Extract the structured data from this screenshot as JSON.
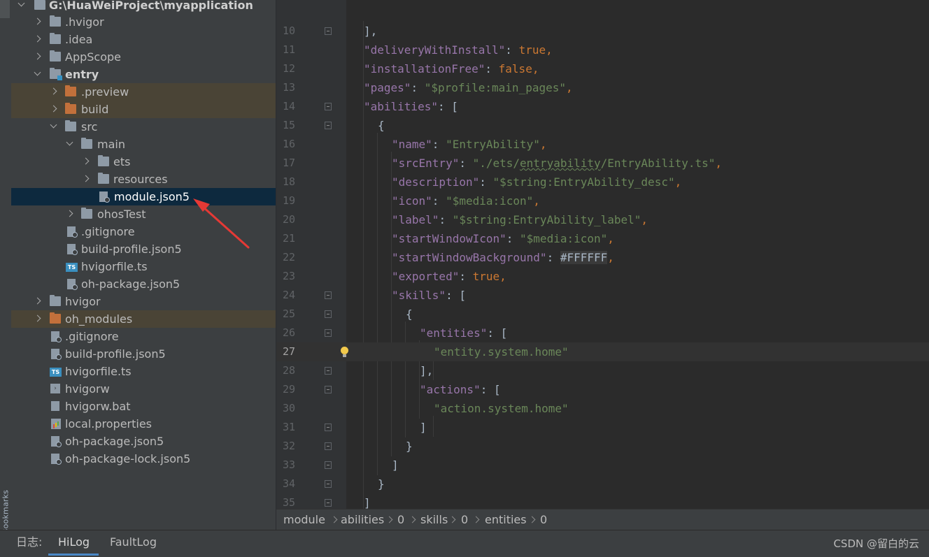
{
  "project_tree": {
    "root": "G:\\HuaWeiProject\\myapplication",
    "items": [
      {
        "label": ".hvigor"
      },
      {
        "label": ".idea"
      },
      {
        "label": "AppScope"
      },
      {
        "label": "entry"
      },
      {
        "label": ".preview"
      },
      {
        "label": "build"
      },
      {
        "label": "src"
      },
      {
        "label": "main"
      },
      {
        "label": "ets"
      },
      {
        "label": "resources"
      },
      {
        "label": "module.json5"
      },
      {
        "label": "ohosTest"
      },
      {
        "label": ".gitignore"
      },
      {
        "label": "build-profile.json5"
      },
      {
        "label": "hvigorfile.ts"
      },
      {
        "label": "oh-package.json5"
      },
      {
        "label": "hvigor"
      },
      {
        "label": "oh_modules"
      },
      {
        "label": ".gitignore"
      },
      {
        "label": "build-profile.json5"
      },
      {
        "label": "hvigorfile.ts"
      },
      {
        "label": "hvigorw"
      },
      {
        "label": "hvigorw.bat"
      },
      {
        "label": "local.properties"
      },
      {
        "label": "oh-package.json5"
      },
      {
        "label": "oh-package-lock.json5"
      }
    ],
    "ts_badge": "TS"
  },
  "side_strip": {
    "bookmarks": "Bookmarks"
  },
  "editor": {
    "line_numbers": [
      "10",
      "11",
      "12",
      "13",
      "14",
      "15",
      "16",
      "17",
      "18",
      "19",
      "20",
      "21",
      "22",
      "23",
      "24",
      "25",
      "26",
      "27",
      "28",
      "29",
      "30",
      "31",
      "32",
      "33",
      "34",
      "35"
    ],
    "current_line": "27",
    "tokens": {
      "l10": "],",
      "k11": "\"deliveryWithInstall\"",
      "v11": "true",
      "k12": "\"installationFree\"",
      "v12": "false",
      "k13": "\"pages\"",
      "v13": "\"$profile:main_pages\"",
      "k14": "\"abilities\"",
      "v14": "[",
      "l15": "{",
      "k16": "\"name\"",
      "v16": "\"EntryAbility\"",
      "k17": "\"srcEntry\"",
      "v17a": "\"./ets/",
      "v17b": "entryability",
      "v17c": "/EntryAbility.ts\"",
      "k18": "\"description\"",
      "v18": "\"$string:EntryAbility_desc\"",
      "k19": "\"icon\"",
      "v19": "\"$media:icon\"",
      "k20": "\"label\"",
      "v20": "\"$string:EntryAbility_label\"",
      "k21": "\"startWindowIcon\"",
      "v21": "\"$media:icon\"",
      "k22": "\"startWindowBackground\"",
      "v22": "#FFFFFF",
      "k23": "\"exported\"",
      "v23": "true",
      "k24": "\"skills\"",
      "v24": "[",
      "l25": "{",
      "k26": "\"entities\"",
      "v26": "[",
      "v27": "\"entity.system.home\"",
      "l28": "],",
      "k29": "\"actions\"",
      "v29": "[",
      "v30": "\"action.system.home\"",
      "l31": "]",
      "l32": "}",
      "l33": "]",
      "l34": "}",
      "l35": "]"
    }
  },
  "breadcrumb": [
    "module",
    "abilities",
    "0",
    "skills",
    "0",
    "entities",
    "0"
  ],
  "bottom_bar": {
    "log_label": "日志:",
    "tabs": [
      "HiLog",
      "FaultLog"
    ],
    "watermark": "CSDN @留白的云"
  }
}
